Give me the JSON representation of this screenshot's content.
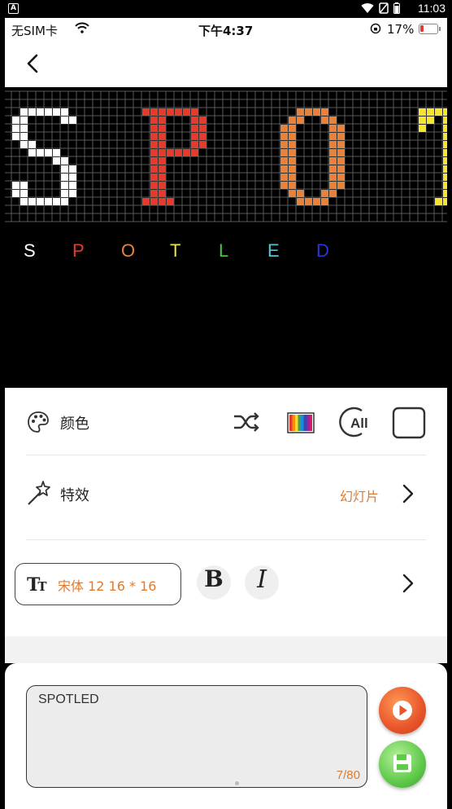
{
  "android_status": {
    "time": "11:03",
    "logo": "A"
  },
  "ios_status": {
    "carrier": "无SIM卡",
    "time": "下午4:37",
    "battery": "17%"
  },
  "led_preview": {
    "letters": [
      {
        "char": "S",
        "color": "#ffffff"
      },
      {
        "char": "P",
        "color": "#e53a2c"
      },
      {
        "char": "O",
        "color": "#e8823a"
      },
      {
        "char": "T",
        "color": "#f5e531"
      }
    ]
  },
  "preview_letters": [
    {
      "char": "S",
      "color": "#ffffff"
    },
    {
      "char": "P",
      "color": "#e53a2c"
    },
    {
      "char": "O",
      "color": "#e8823a"
    },
    {
      "char": "T",
      "color": "#e8e24a"
    },
    {
      "char": "L",
      "color": "#3fc53f"
    },
    {
      "char": "E",
      "color": "#4ec7d4"
    },
    {
      "char": "D",
      "color": "#2a35d6"
    }
  ],
  "color_row": {
    "label": "颜色"
  },
  "effect_row": {
    "label": "特效",
    "value": "幻灯片"
  },
  "font_row": {
    "font_name": "宋体 12 16 * 16",
    "bold": "B",
    "italic": "I"
  },
  "input": {
    "text": "SPOTLED",
    "count": "7/80"
  },
  "colors": {
    "accent": "#e07a2e",
    "play": "#e8542a",
    "save": "#5fc94a"
  }
}
